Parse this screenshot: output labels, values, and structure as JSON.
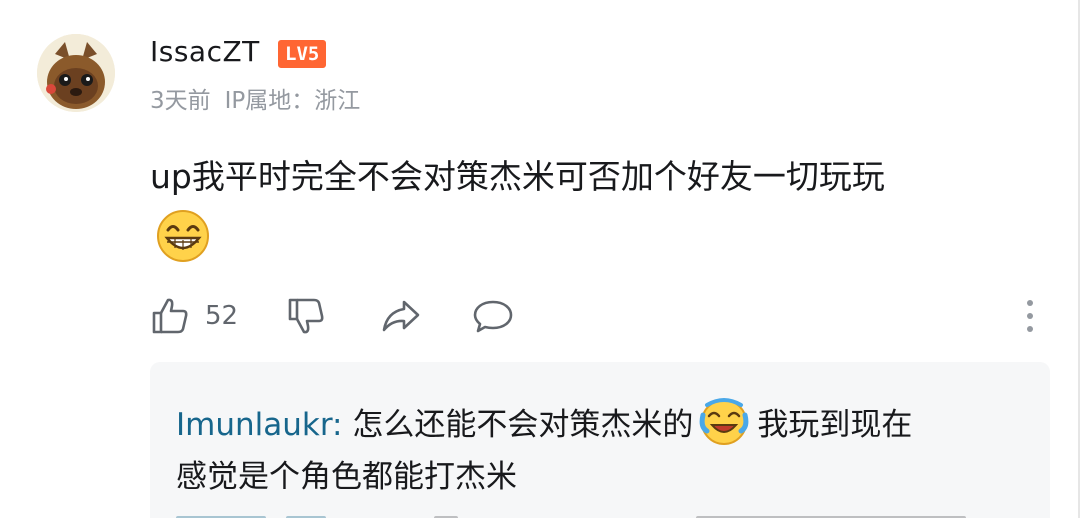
{
  "comment": {
    "username": "IssacZT",
    "level": "LV5",
    "time": "3天前",
    "ip_location": "IP属地：浙江",
    "text": "up我平时完全不会对策杰米可否加个好友一切玩玩",
    "emoji_icon": "grinning-face-icon"
  },
  "actions": {
    "like_count": "52",
    "icons": [
      "thumb-up-icon",
      "thumb-down-icon",
      "share-icon",
      "comment-icon",
      "more-icon"
    ]
  },
  "reply": {
    "username": "Imunlaukr",
    "separator": ": ",
    "text_before_emoji": "怎么还能不会对策杰米的",
    "emoji_icon": "laughing-crying-face-icon",
    "text_after_emoji": "我玩到现在",
    "text_line2": "感觉是个角色都能打杰米"
  },
  "colors": {
    "username": "#18191c",
    "meta": "#9499a0",
    "level_badge": "#ff6633",
    "reply_user": "#17668c",
    "reply_bg": "#f6f7f8",
    "action_icons": "#61666d"
  }
}
